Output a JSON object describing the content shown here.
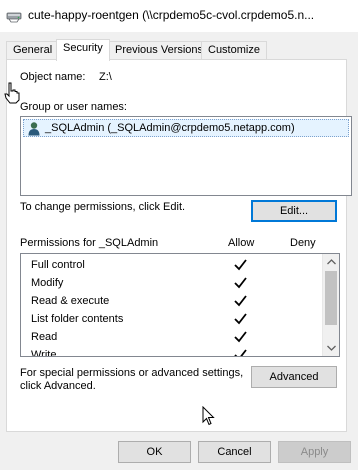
{
  "window": {
    "title": "cute-happy-roentgen (\\\\crpdemo5c-cvol.crpdemo5.n..."
  },
  "tabs": [
    {
      "label": "General",
      "active": false
    },
    {
      "label": "Security",
      "active": true
    },
    {
      "label": "Previous Versions",
      "active": false
    },
    {
      "label": "Customize",
      "active": false
    }
  ],
  "object": {
    "label": "Object name:",
    "value": "Z:\\"
  },
  "group": {
    "label": "Group or user names:",
    "users": [
      {
        "name": "_SQLAdmin (_SQLAdmin@crpdemo5.netapp.com)",
        "icon": "user-icon",
        "selected": true
      }
    ]
  },
  "edit": {
    "hint": "To change permissions, click Edit.",
    "button_label": "Edit..."
  },
  "permissions": {
    "header": "Permissions for _SQLAdmin",
    "allow_label": "Allow",
    "deny_label": "Deny",
    "rows": [
      {
        "name": "Full control",
        "allow": true,
        "deny": false
      },
      {
        "name": "Modify",
        "allow": true,
        "deny": false
      },
      {
        "name": "Read & execute",
        "allow": true,
        "deny": false
      },
      {
        "name": "List folder contents",
        "allow": true,
        "deny": false
      },
      {
        "name": "Read",
        "allow": true,
        "deny": false
      },
      {
        "name": "Write",
        "allow": true,
        "deny": false
      }
    ]
  },
  "advanced": {
    "hint_line1": "For special permissions or advanced settings,",
    "hint_line2": "click Advanced.",
    "button_label": "Advanced"
  },
  "footer": {
    "ok_label": "OK",
    "cancel_label": "Cancel",
    "apply_label": "Apply"
  },
  "colors": {
    "accent": "#0078d7",
    "selection": "#e5f3ff"
  }
}
